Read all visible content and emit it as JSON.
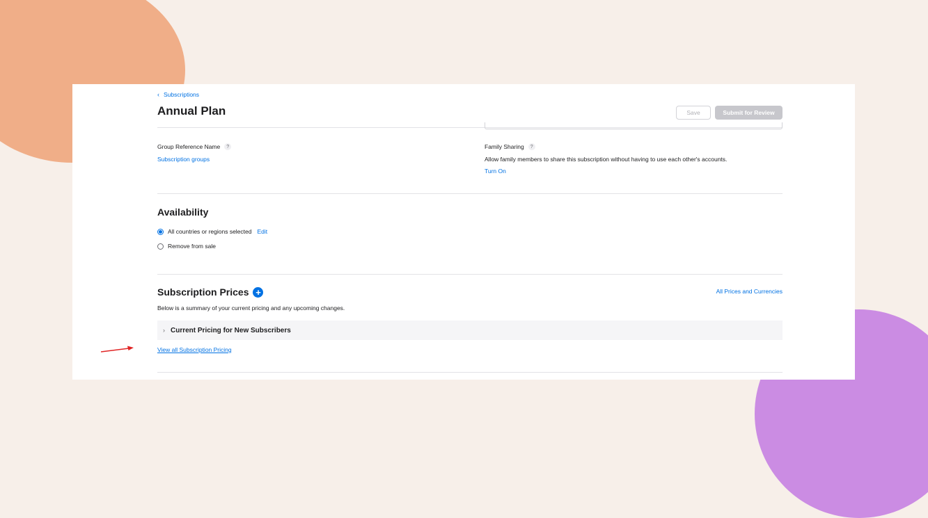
{
  "header": {
    "breadcrumb": "Subscriptions",
    "title": "Annual Plan",
    "save_label": "Save",
    "submit_label": "Submit for Review"
  },
  "group_reference": {
    "label": "Group Reference Name",
    "help": "?",
    "link": "Subscription groups"
  },
  "family_sharing": {
    "label": "Family Sharing",
    "help": "?",
    "description": "Allow family members to share this subscription without having to use each other's accounts.",
    "action": "Turn On"
  },
  "availability": {
    "heading": "Availability",
    "options": [
      {
        "label": "All countries or regions selected",
        "selected": true,
        "action": "Edit"
      },
      {
        "label": "Remove from sale",
        "selected": false
      }
    ]
  },
  "prices": {
    "heading": "Subscription Prices",
    "add_icon": "plus-circle-icon",
    "all_prices_link": "All Prices and Currencies",
    "summary": "Below is a summary of your current pricing and any upcoming changes.",
    "accordion_label": "Current Pricing for New Subscribers",
    "view_all_link": "View all Subscription Pricing"
  },
  "colors": {
    "accent": "#0071e3",
    "background": "#f7efe9",
    "annotation_arrow": "#e02424"
  }
}
